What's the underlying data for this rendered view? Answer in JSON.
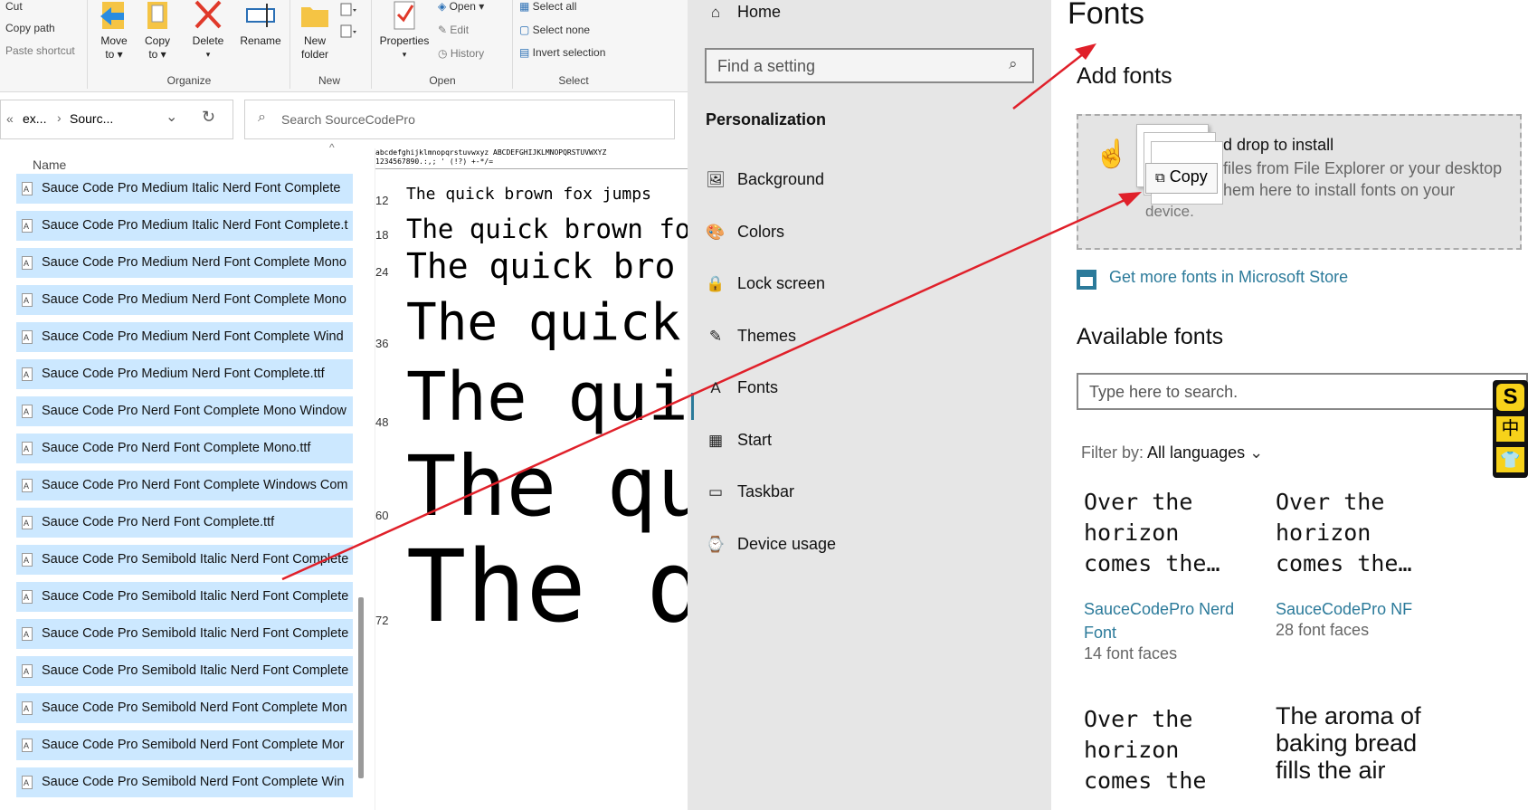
{
  "explorer": {
    "ribbon": {
      "clipboard": {
        "cut": "Cut",
        "copy_path": "Copy path",
        "paste_shortcut": "Paste shortcut"
      },
      "organize": {
        "move_to": "Move",
        "move_to2": "to ▾",
        "copy_to": "Copy",
        "copy_to2": "to ▾",
        "delete": "Delete",
        "rename": "Rename",
        "group": "Organize"
      },
      "new": {
        "new_folder": "New",
        "new_folder2": "folder",
        "group": "New"
      },
      "open": {
        "properties": "Properties",
        "open": "Open ▾",
        "edit": "Edit",
        "history": "History",
        "group": "Open"
      },
      "select": {
        "select_all": "Select all",
        "select_none": "Select none",
        "invert": "Invert selection",
        "group": "Select"
      }
    },
    "address": {
      "part1": "ex...",
      "part2": "Sourc..."
    },
    "search_placeholder": "Search SourceCodePro",
    "column_name": "Name",
    "files": [
      "Sauce Code Pro Medium Italic Nerd Font Complete",
      "Sauce Code Pro Medium Italic Nerd Font Complete.t",
      "Sauce Code Pro Medium Nerd Font Complete Mono",
      "Sauce Code Pro Medium Nerd Font Complete Mono",
      "Sauce Code Pro Medium Nerd Font Complete Wind",
      "Sauce Code Pro Medium Nerd Font Complete.ttf",
      "Sauce Code Pro Nerd Font Complete Mono Window",
      "Sauce Code Pro Nerd Font Complete Mono.ttf",
      "Sauce Code Pro Nerd Font Complete Windows Com",
      "Sauce Code Pro Nerd Font Complete.ttf",
      "Sauce Code Pro Semibold Italic Nerd Font Complete",
      "Sauce Code Pro Semibold Italic Nerd Font Complete",
      "Sauce Code Pro Semibold Italic Nerd Font Complete",
      "Sauce Code Pro Semibold Italic Nerd Font Complete",
      "Sauce Code Pro Semibold Nerd Font Complete Mon",
      "Sauce Code Pro Semibold Nerd Font Complete Mor",
      "Sauce Code Pro Semibold Nerd Font Complete Win"
    ],
    "preview": {
      "charset1": "abcdefghijklmnopqrstuvwxyz ABCDEFGHIJKLMNOPQRSTUVWXYZ",
      "charset2": "1234567890.:,; '  (!?) +-*/=",
      "sizes": [
        {
          "size": "12",
          "text": "The quick brown fox jumps"
        },
        {
          "size": "18",
          "text": "The quick brown fo"
        },
        {
          "size": "24",
          "text": "The quick bro"
        },
        {
          "size": "36",
          "text": "The quick"
        },
        {
          "size": "48",
          "text": "The qui"
        },
        {
          "size": "60",
          "text": "The qu"
        },
        {
          "size": "72",
          "text": "The q"
        }
      ]
    }
  },
  "settings_nav": {
    "home": "Home",
    "find_placeholder": "Find a setting",
    "section": "Personalization",
    "items": [
      "Background",
      "Colors",
      "Lock screen",
      "Themes",
      "Fonts",
      "Start",
      "Taskbar",
      "Device usage"
    ]
  },
  "fonts_page": {
    "title": "Fonts",
    "add_fonts": "Add fonts",
    "drop_line1": "d drop to install",
    "drop_line2": "files from File Explorer or your desktop",
    "drop_line3": "hem here to install fonts on your",
    "drop_line4": "device.",
    "drag_tooltip": "Copy",
    "store_link": "Get more fonts in Microsoft Store",
    "available": "Available fonts",
    "search_placeholder": "Type here to search.",
    "filter_label": "Filter by:",
    "filter_value": "All languages",
    "cards": [
      {
        "sample": "Over the\nhorizon\ncomes the…",
        "name1": "SauceCodePro Nerd",
        "name2": "Font",
        "faces": "14 font faces"
      },
      {
        "sample": "Over the\nhorizon\ncomes the…",
        "name1": "SauceCodePro NF",
        "name2": "",
        "faces": "28 font faces"
      },
      {
        "sample": "Over the\nhorizon\ncomes the",
        "name1": "",
        "name2": "",
        "faces": ""
      },
      {
        "sample": "The aroma of\nbaking bread\nfills the air",
        "name1": "",
        "name2": "",
        "faces": ""
      }
    ],
    "ime_badge": {
      "s": "S",
      "zh": "中"
    }
  },
  "colors": {
    "selection": "#cce8ff",
    "accent": "#2b7a9a",
    "arrow": "#e0202a",
    "nav_bg": "#e6e6e6"
  }
}
